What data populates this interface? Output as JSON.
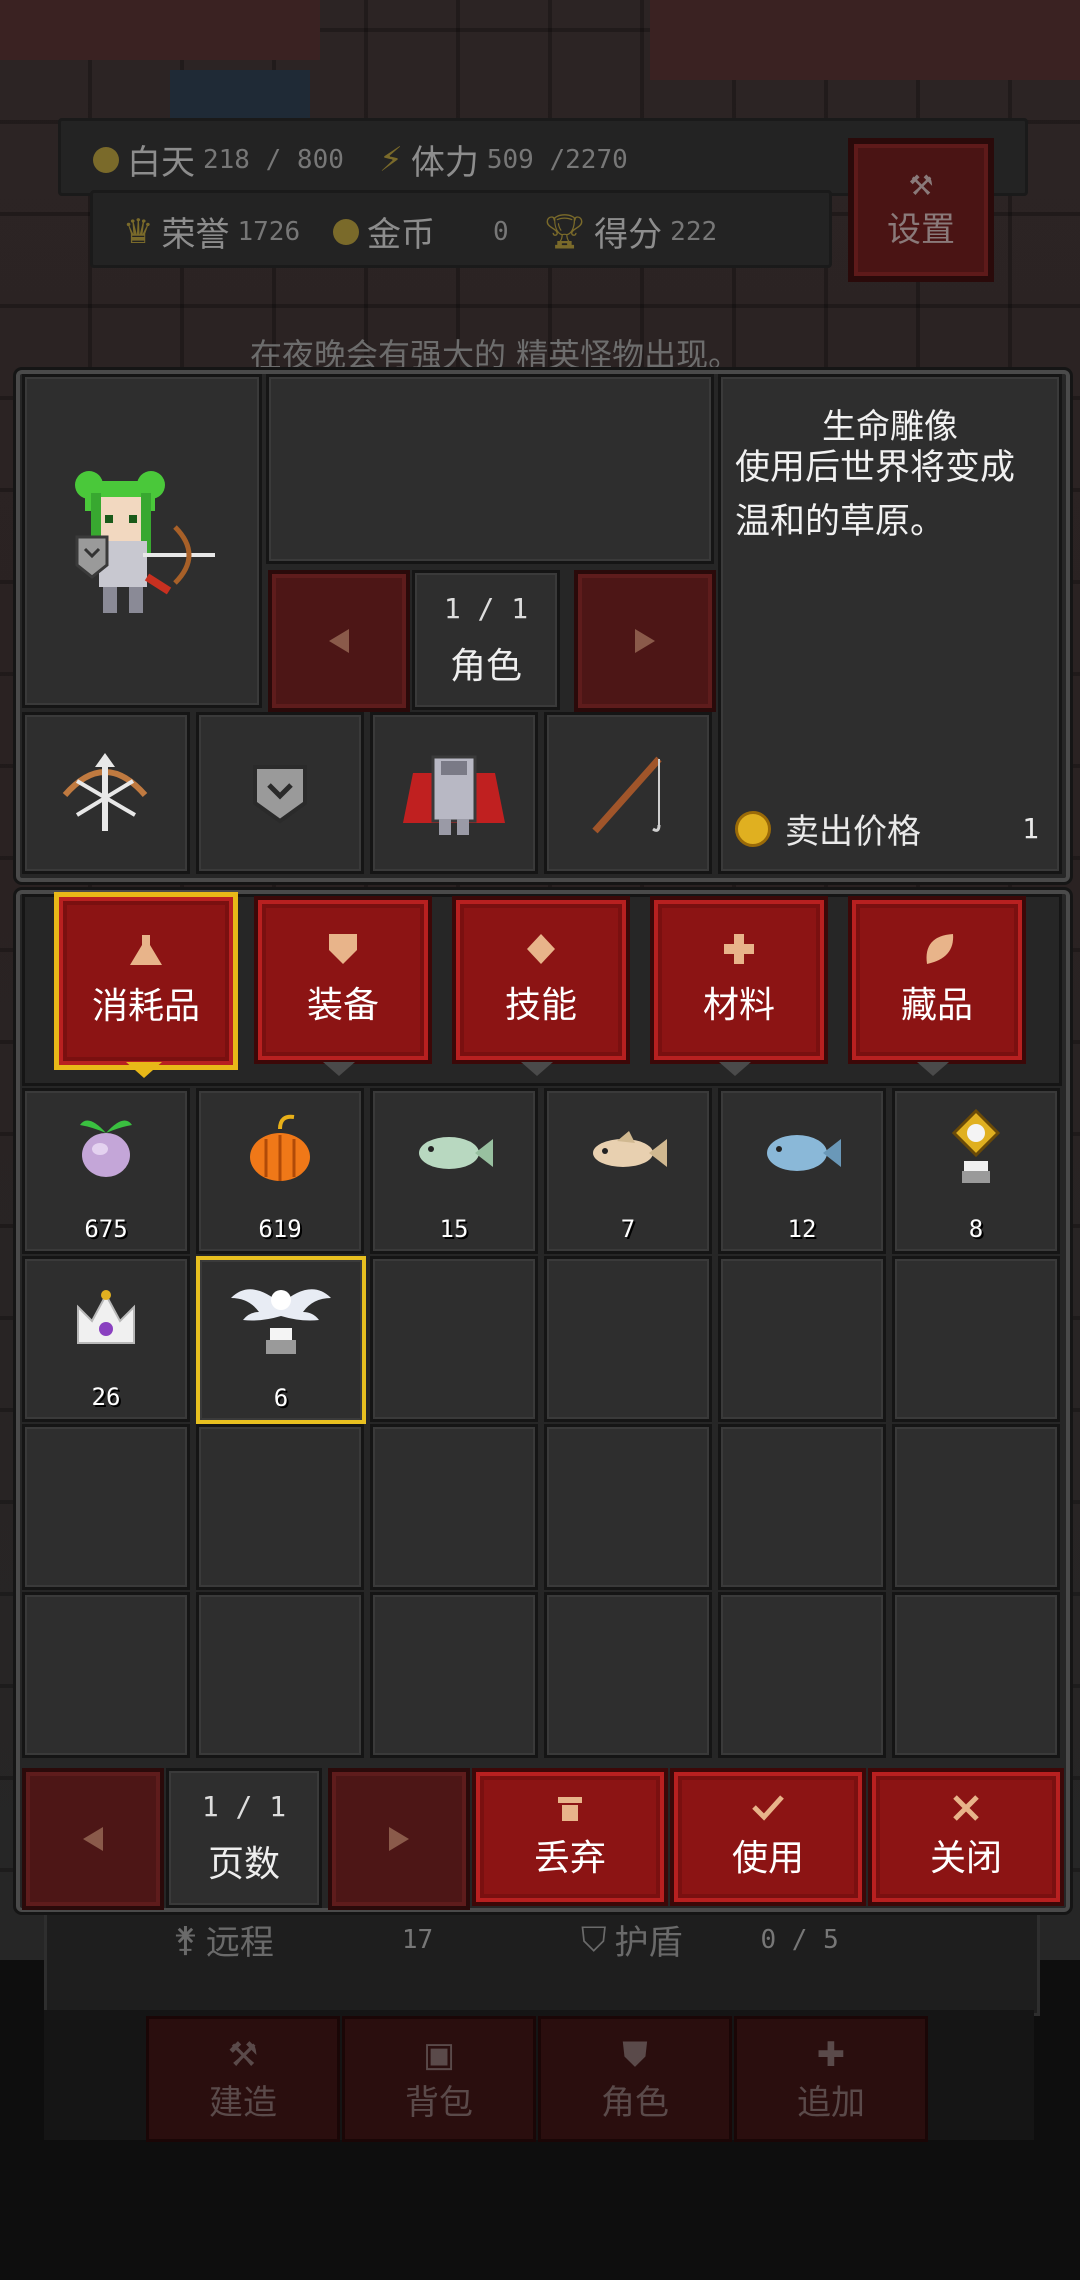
{
  "hud": {
    "day_label": "白天",
    "day_value": "218 / 800",
    "stamina_label": "体力",
    "stamina_value": "509 /2270",
    "honor_label": "荣誉",
    "honor_value": "1726",
    "gold_label": "金币",
    "gold_value": "0",
    "score_label": "得分",
    "score_value": "222",
    "settings_label": "设置",
    "hint_text": "在夜晚会有强大的 精英怪物出现。"
  },
  "character": {
    "pager_text": "1 / 1",
    "pager_label": "角色",
    "equip_slots": [
      {
        "icon": "crossbow-icon"
      },
      {
        "icon": "shield-icon"
      },
      {
        "icon": "armor-icon"
      },
      {
        "icon": "fishing-rod-icon"
      }
    ]
  },
  "detail": {
    "title": "生命雕像",
    "line1": "使用后世界将变成",
    "line2": "温和的草原。",
    "sell_label": "卖出价格",
    "sell_value": "1"
  },
  "tabs": [
    {
      "label": "消耗品",
      "icon": "potion-icon",
      "selected": true
    },
    {
      "label": "装备",
      "icon": "shield-icon",
      "selected": false
    },
    {
      "label": "技能",
      "icon": "diamond-icon",
      "selected": false
    },
    {
      "label": "材料",
      "icon": "plus-icon",
      "selected": false
    },
    {
      "label": "藏品",
      "icon": "leaf-icon",
      "selected": false
    }
  ],
  "inventory": [
    {
      "icon": "turnip-icon",
      "count": "675"
    },
    {
      "icon": "pumpkin-icon",
      "count": "619"
    },
    {
      "icon": "green-fish-icon",
      "count": "15"
    },
    {
      "icon": "tan-fish-icon",
      "count": "7"
    },
    {
      "icon": "blue-fish-icon",
      "count": "12"
    },
    {
      "icon": "gold-statue-icon",
      "count": "8"
    },
    {
      "icon": "crown-icon",
      "count": "26"
    },
    {
      "icon": "winged-statue-icon",
      "count": "6",
      "selected": true
    }
  ],
  "footer": {
    "pager_text": "1 / 1",
    "pager_label": "页数",
    "discard_label": "丢弃",
    "use_label": "使用",
    "close_label": "关闭"
  },
  "background_bar": {
    "ranged_label": "远程",
    "ranged_value": "17",
    "shield_label": "护盾",
    "shield_value": "0 / 5",
    "nav": [
      "建造",
      "背包",
      "角色",
      "追加"
    ]
  }
}
